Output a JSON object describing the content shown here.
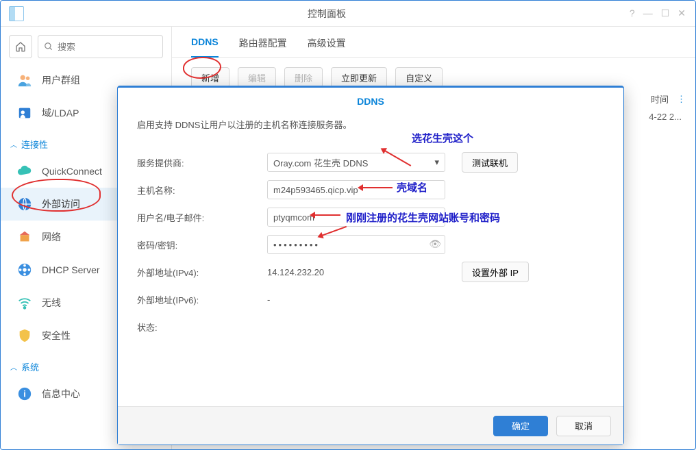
{
  "window": {
    "title": "控制面板",
    "help": "?",
    "min": "—",
    "max": "☐",
    "close": "✕"
  },
  "search": {
    "placeholder": "搜索"
  },
  "sidebar": {
    "items": [
      {
        "label": "用户群组",
        "icon": "users"
      },
      {
        "label": "域/LDAP",
        "icon": "domain"
      }
    ],
    "section_connect": "连接性",
    "connect_items": [
      {
        "label": "QuickConnect",
        "icon": "cloud"
      },
      {
        "label": "外部访问",
        "icon": "globe"
      },
      {
        "label": "网络",
        "icon": "router"
      },
      {
        "label": "DHCP Server",
        "icon": "dhcp"
      },
      {
        "label": "无线",
        "icon": "wifi"
      },
      {
        "label": "安全性",
        "icon": "shield"
      }
    ],
    "section_system": "系统",
    "system_items": [
      {
        "label": "信息中心",
        "icon": "info"
      }
    ]
  },
  "tabs": {
    "ddns": "DDNS",
    "router": "路由器配置",
    "advanced": "高级设置"
  },
  "actions": {
    "add": "新增",
    "edit": "编辑",
    "delete": "删除",
    "update": "立即更新",
    "custom": "自定义"
  },
  "table": {
    "col_time": "时间",
    "row0_time": "4-22 2..."
  },
  "modal": {
    "title": "DDNS",
    "intro": "启用支持 DDNS让用户以注册的主机名称连接服务器。",
    "labels": {
      "provider": "服务提供商:",
      "hostname": "主机名称:",
      "user": "用户名/电子邮件:",
      "password": "密码/密钥:",
      "ipv4": "外部地址(IPv4):",
      "ipv6": "外部地址(IPv6):",
      "status": "状态:"
    },
    "values": {
      "provider": "Oray.com 花生壳 DDNS",
      "hostname": "m24p593465.qicp.vip",
      "user": "ptyqmcom",
      "password": "•••••••••",
      "ipv4": "14.124.232.20",
      "ipv6": "-",
      "status": ""
    },
    "buttons": {
      "test": "测试联机",
      "set_ip": "设置外部 IP",
      "ok": "确定",
      "cancel": "取消"
    }
  },
  "annotations": {
    "provider": "选花生壳这个",
    "hostname": "壳域名",
    "user": "刚刚注册的花生壳网站账号和密码"
  }
}
